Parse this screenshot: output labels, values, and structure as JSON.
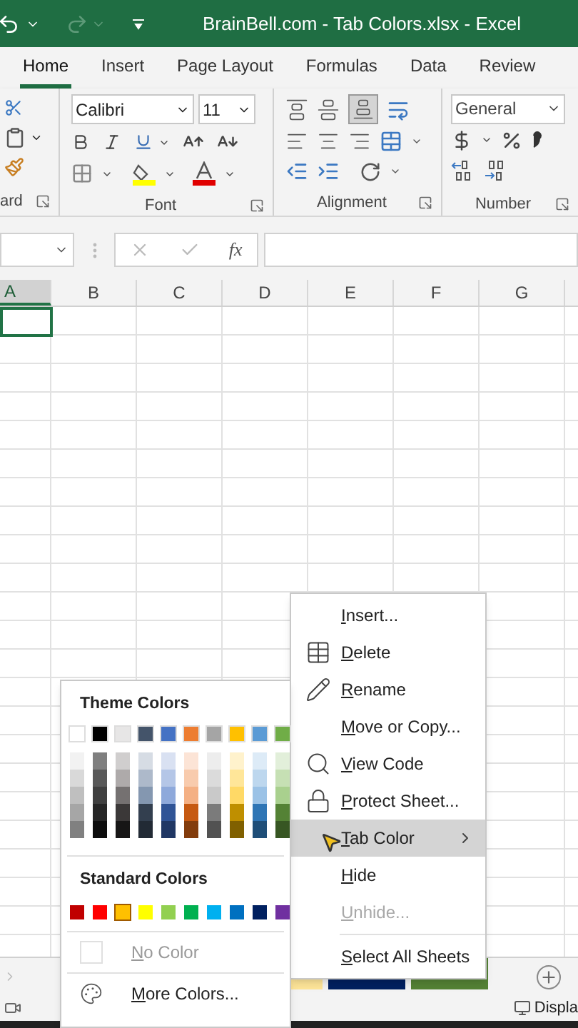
{
  "window": {
    "title": "BrainBell.com - Tab Colors.xlsx  -  Excel"
  },
  "ribbon_tabs": [
    {
      "label": "Home",
      "selected": true
    },
    {
      "label": "Insert",
      "selected": false
    },
    {
      "label": "Page Layout",
      "selected": false
    },
    {
      "label": "Formulas",
      "selected": false
    },
    {
      "label": "Data",
      "selected": false
    },
    {
      "label": "Review",
      "selected": false
    }
  ],
  "ribbon": {
    "font_name": "Calibri",
    "font_size": "11",
    "number_format": "General",
    "groups": [
      "ard",
      "Font",
      "Alignment",
      "Number"
    ]
  },
  "formula_bar": {
    "fx": "fx"
  },
  "columns": [
    {
      "label": "A",
      "selected": true
    },
    {
      "label": "B",
      "selected": false
    },
    {
      "label": "C",
      "selected": false
    },
    {
      "label": "D",
      "selected": false
    },
    {
      "label": "E",
      "selected": false
    },
    {
      "label": "F",
      "selected": false
    },
    {
      "label": "G",
      "selected": false
    }
  ],
  "context_menu": [
    {
      "label": "Insert...",
      "kind": "plain",
      "selected": false,
      "disabled": false,
      "submenu": false
    },
    {
      "label": "Delete",
      "kind": "delete",
      "selected": false,
      "disabled": false,
      "submenu": false
    },
    {
      "label": "Rename",
      "kind": "rename",
      "selected": false,
      "disabled": false,
      "submenu": false
    },
    {
      "label": "Move or Copy...",
      "kind": "plain",
      "selected": false,
      "disabled": false,
      "submenu": false
    },
    {
      "label": "View Code",
      "kind": "code",
      "selected": false,
      "disabled": false,
      "submenu": false
    },
    {
      "label": "Protect Sheet...",
      "kind": "protect",
      "selected": false,
      "disabled": false,
      "submenu": false
    },
    {
      "label": "Tab Color",
      "kind": "plain",
      "selected": true,
      "disabled": false,
      "submenu": true
    },
    {
      "label": "Hide",
      "kind": "plain",
      "selected": false,
      "disabled": false,
      "submenu": false
    },
    {
      "label": "Unhide...",
      "kind": "plain",
      "selected": false,
      "disabled": true,
      "submenu": false
    },
    {
      "label": "Select All Sheets",
      "kind": "plain",
      "selected": false,
      "disabled": false,
      "submenu": false
    }
  ],
  "color_palette": {
    "theme_title": "Theme Colors",
    "theme_colors": [
      {
        "color": "#ffffff",
        "shades": [
          {
            "color": "#f2f2f2"
          },
          {
            "color": "#d9d9d9"
          },
          {
            "color": "#bfbfbf"
          },
          {
            "color": "#a6a6a6"
          },
          {
            "color": "#808080"
          }
        ]
      },
      {
        "color": "#000000",
        "shades": [
          {
            "color": "#7f7f7f"
          },
          {
            "color": "#595959"
          },
          {
            "color": "#404040"
          },
          {
            "color": "#262626"
          },
          {
            "color": "#0d0d0d"
          }
        ]
      },
      {
        "color": "#e7e6e6",
        "shades": [
          {
            "color": "#d0cece"
          },
          {
            "color": "#aeaaaa"
          },
          {
            "color": "#757171"
          },
          {
            "color": "#3b3838"
          },
          {
            "color": "#171616"
          }
        ]
      },
      {
        "color": "#44546a",
        "shades": [
          {
            "color": "#d6dce4"
          },
          {
            "color": "#adb9ca"
          },
          {
            "color": "#8497b0"
          },
          {
            "color": "#333f4f"
          },
          {
            "color": "#222a35"
          }
        ]
      },
      {
        "color": "#4472c4",
        "shades": [
          {
            "color": "#d9e1f2"
          },
          {
            "color": "#b4c6e7"
          },
          {
            "color": "#8ea9db"
          },
          {
            "color": "#305496"
          },
          {
            "color": "#203764"
          }
        ]
      },
      {
        "color": "#ed7d31",
        "shades": [
          {
            "color": "#fce4d6"
          },
          {
            "color": "#f8cbad"
          },
          {
            "color": "#f4b084"
          },
          {
            "color": "#c65911"
          },
          {
            "color": "#833c0c"
          }
        ]
      },
      {
        "color": "#a5a5a5",
        "shades": [
          {
            "color": "#ededed"
          },
          {
            "color": "#dbdbdb"
          },
          {
            "color": "#c9c9c9"
          },
          {
            "color": "#7b7b7b"
          },
          {
            "color": "#525252"
          }
        ]
      },
      {
        "color": "#ffc000",
        "shades": [
          {
            "color": "#fff2cc"
          },
          {
            "color": "#ffe699"
          },
          {
            "color": "#ffd966"
          },
          {
            "color": "#bf8f00"
          },
          {
            "color": "#806000"
          }
        ]
      },
      {
        "color": "#5b9bd5",
        "shades": [
          {
            "color": "#ddebf7"
          },
          {
            "color": "#bdd7ee"
          },
          {
            "color": "#9bc2e6"
          },
          {
            "color": "#2f75b5"
          },
          {
            "color": "#1f4e78"
          }
        ]
      },
      {
        "color": "#70ad47",
        "shades": [
          {
            "color": "#e2efda"
          },
          {
            "color": "#c6e0b4"
          },
          {
            "color": "#a9d08e"
          },
          {
            "color": "#548235"
          },
          {
            "color": "#375623"
          }
        ]
      }
    ],
    "standard_title": "Standard Colors",
    "standard_colors": [
      {
        "color": "#c00000",
        "selected": false
      },
      {
        "color": "#ff0000",
        "selected": false
      },
      {
        "color": "#ffc000",
        "selected": true
      },
      {
        "color": "#ffff00",
        "selected": false
      },
      {
        "color": "#92d050",
        "selected": false
      },
      {
        "color": "#00b050",
        "selected": false
      },
      {
        "color": "#00b0f0",
        "selected": false
      },
      {
        "color": "#0070c0",
        "selected": false
      },
      {
        "color": "#002060",
        "selected": false
      },
      {
        "color": "#7030a0",
        "selected": false
      }
    ],
    "no_color": "No Color",
    "more_colors": "More Colors..."
  },
  "sheet_tabs": [
    {
      "color": "#ffe699"
    },
    {
      "color": "#002060"
    },
    {
      "color": "#548235"
    }
  ],
  "status_bar": {
    "display": "Displa"
  }
}
